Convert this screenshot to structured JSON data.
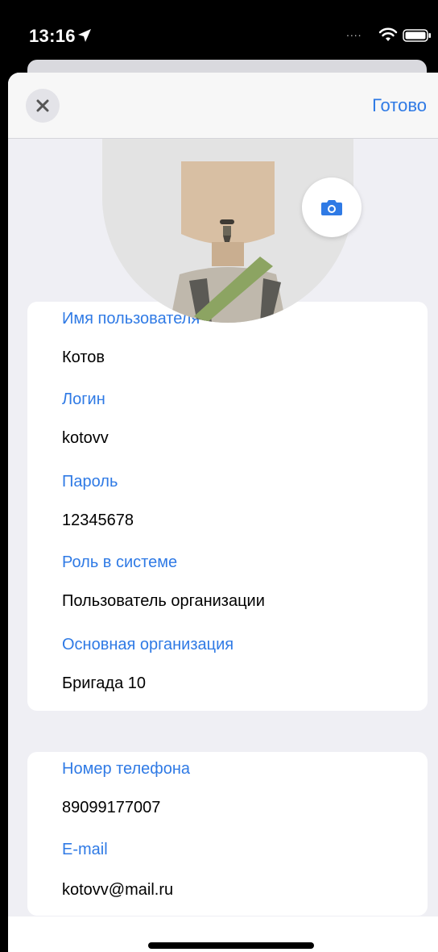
{
  "status_bar": {
    "time": "13:16",
    "dots": "....",
    "icons": [
      "location-arrow-icon",
      "wifi-icon",
      "battery-icon"
    ]
  },
  "nav": {
    "close_icon": "close-icon",
    "done_label": "Готово"
  },
  "avatar": {
    "camera_icon": "camera-icon"
  },
  "account_card": {
    "fields": [
      {
        "label": "Имя пользователя",
        "value": "Котов"
      },
      {
        "label": "Логин",
        "value": "kotovv"
      },
      {
        "label": "Пароль",
        "value": "12345678"
      },
      {
        "label": "Роль в системе",
        "value": "Пользователь организации"
      },
      {
        "label": "Основная организация",
        "value": "Бригада 10"
      }
    ]
  },
  "contact_card": {
    "fields": [
      {
        "label": "Номер телефона",
        "value": "89099177007"
      },
      {
        "label": "E-mail",
        "value": "kotovv@mail.ru"
      }
    ]
  },
  "colors": {
    "accent": "#2f7ae5",
    "background": "#efeff4",
    "card": "#ffffff"
  }
}
